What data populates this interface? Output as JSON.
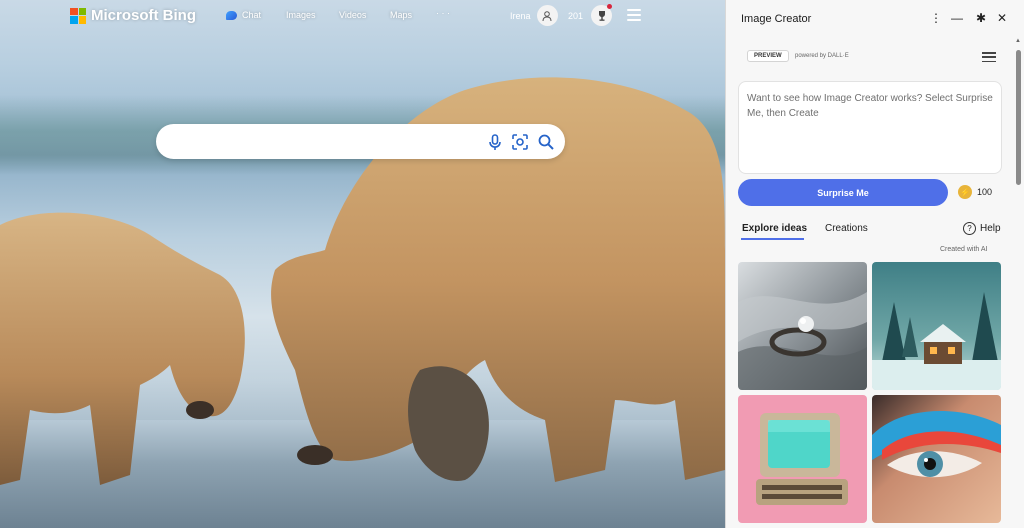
{
  "bing": {
    "brand": "Microsoft Bing",
    "nav": {
      "chat": "Chat",
      "images": "Images",
      "videos": "Videos",
      "maps": "Maps",
      "more": "· · ·"
    },
    "user_name": "Irena",
    "rewards_points": "201",
    "search_placeholder": "",
    "logo_colors": [
      "#f25022",
      "#7fba00",
      "#00a4ef",
      "#ffb900"
    ]
  },
  "panel": {
    "title": "Image Creator",
    "controls": {
      "more": "⋮",
      "minimize": "—",
      "pin": "✱",
      "close": "✕"
    },
    "preview_badge": "PREVIEW",
    "powered_by": "powered by DALL·E",
    "prompt_placeholder": "Want to see how Image Creator works? Select Surprise Me, then Create",
    "surprise_button": "Surprise Me",
    "boost_count": "100",
    "tabs": {
      "explore": "Explore ideas",
      "creations": "Creations"
    },
    "help": "Help",
    "created_with_ai": "Created with AI",
    "accent_color": "#4f6fe8"
  }
}
